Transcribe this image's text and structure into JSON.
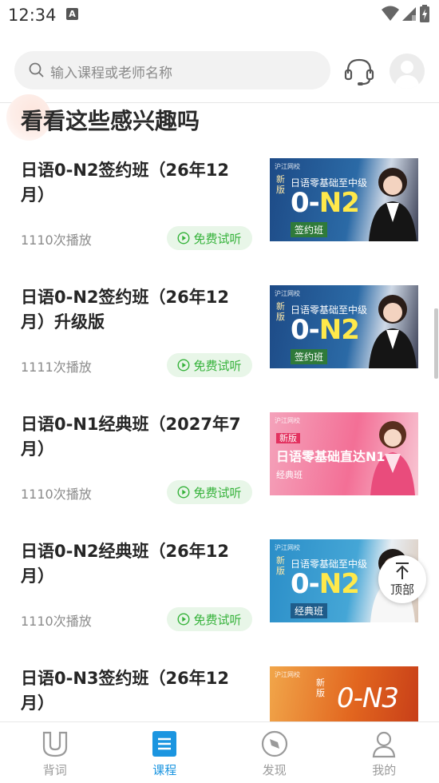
{
  "status": {
    "time": "12:34",
    "notif_badge": "A"
  },
  "search": {
    "placeholder": "输入课程或老师名称"
  },
  "section": {
    "title": "看看这些感兴趣吗"
  },
  "courses": [
    {
      "title": "日语0-N2签约班（26年12月）",
      "plays": "1110次播放",
      "trial": "免费试听",
      "thumb": {
        "logo": "沪江网校",
        "new": "新版",
        "subtitle": "日语零基础至中级",
        "code_a": "0-",
        "code_b": "N2",
        "tag": "签约班",
        "bg": "#1f4f8a"
      }
    },
    {
      "title": "日语0-N2签约班（26年12月）升级版",
      "plays": "1111次播放",
      "trial": "免费试听",
      "thumb": {
        "logo": "沪江网校",
        "new": "新版",
        "subtitle": "日语零基础至中级",
        "code_a": "0-",
        "code_b": "N2",
        "tag": "签约班",
        "bg": "#1f4f8a"
      }
    },
    {
      "title": "日语0-N1经典班（2027年7月）",
      "plays": "1110次播放",
      "trial": "免费试听",
      "thumb": {
        "logo": "沪江网校",
        "new": "新版",
        "subtitle": "日语零基础直达N1",
        "code_a": "",
        "code_b": "",
        "tag": "经典班",
        "bg": "#f06c92"
      }
    },
    {
      "title": "日语0-N2经典班（26年12月）",
      "plays": "1110次播放",
      "trial": "免费试听",
      "thumb": {
        "logo": "沪江网校",
        "new": "新版",
        "subtitle": "日语零基础至中级",
        "code_a": "0-",
        "code_b": "N2",
        "tag": "经典班",
        "bg": "#2a8fc8"
      }
    },
    {
      "title": "日语0-N3签约班（26年12月）",
      "plays": "",
      "trial": "",
      "thumb": {
        "logo": "沪江网校",
        "new": "新版",
        "subtitle": "",
        "code_a": "0-N3",
        "code_b": "",
        "tag": "",
        "bg": "#e2661f"
      }
    }
  ],
  "to_top": {
    "label": "顶部"
  },
  "tabs": [
    {
      "label": "背词",
      "icon": "flashcard-icon",
      "active": false
    },
    {
      "label": "课程",
      "icon": "course-icon",
      "active": true
    },
    {
      "label": "发现",
      "icon": "compass-icon",
      "active": false
    },
    {
      "label": "我的",
      "icon": "person-icon",
      "active": false
    }
  ],
  "colors": {
    "accent": "#1b95e0",
    "trial_green": "#35b23a",
    "trial_bg": "#e8f6e8"
  }
}
